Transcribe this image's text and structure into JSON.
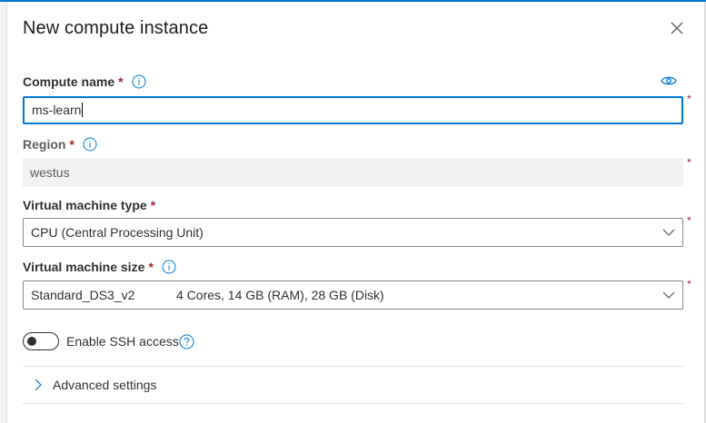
{
  "dialog": {
    "title": "New compute instance"
  },
  "compute_name": {
    "label": "Compute name",
    "required_mark": "*",
    "value": "ms-learn"
  },
  "region": {
    "label": "Region",
    "required_mark": "*",
    "value": "westus"
  },
  "vm_type": {
    "label": "Virtual machine type",
    "required_mark": "*",
    "selected": "CPU (Central Processing Unit)"
  },
  "vm_size": {
    "label": "Virtual machine size",
    "required_mark": "*",
    "selected_name": "Standard_DS3_v2",
    "selected_detail": "4 Cores, 14 GB (RAM), 28 GB (Disk)"
  },
  "ssh": {
    "label": "Enable SSH access",
    "enabled": false
  },
  "advanced": {
    "label": "Advanced settings"
  },
  "side_required_mark": "*",
  "colors": {
    "accent": "#0078d4",
    "required": "#a4262c",
    "border": "#8a8886",
    "disabled_bg": "#f3f2f1"
  }
}
